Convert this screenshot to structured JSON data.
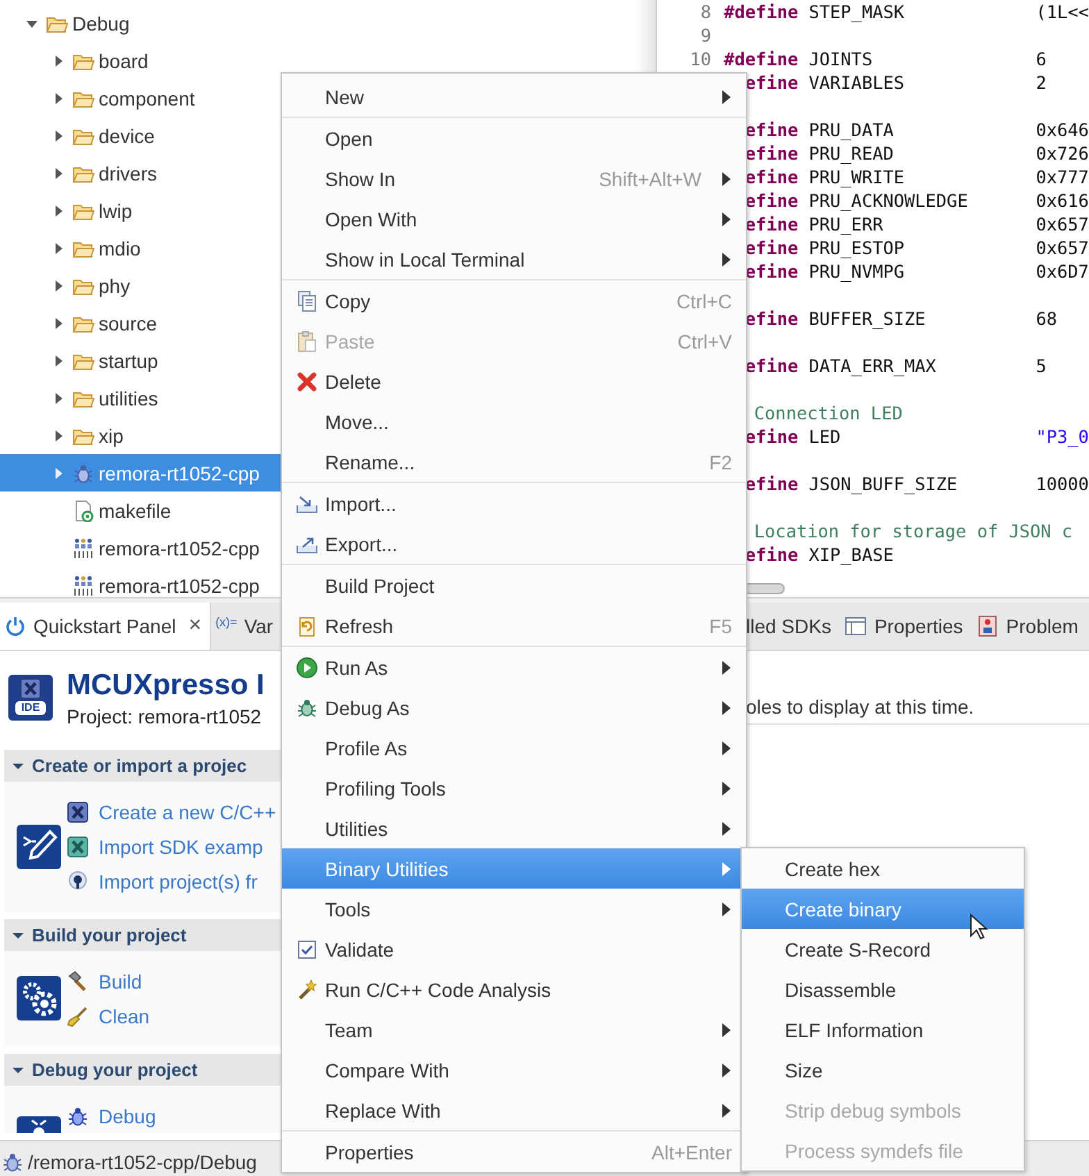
{
  "tree": {
    "items": [
      {
        "label": "Debug",
        "kind": "folder",
        "expanded": true,
        "selected": false,
        "children": [
          {
            "label": "board",
            "kind": "folder",
            "expanded": false,
            "selected": false
          },
          {
            "label": "component",
            "kind": "folder",
            "expanded": false,
            "selected": false
          },
          {
            "label": "device",
            "kind": "folder",
            "expanded": false,
            "selected": false
          },
          {
            "label": "drivers",
            "kind": "folder",
            "expanded": false,
            "selected": false
          },
          {
            "label": "lwip",
            "kind": "folder",
            "expanded": false,
            "selected": false
          },
          {
            "label": "mdio",
            "kind": "folder",
            "expanded": false,
            "selected": false
          },
          {
            "label": "phy",
            "kind": "folder",
            "expanded": false,
            "selected": false
          },
          {
            "label": "source",
            "kind": "folder",
            "expanded": false,
            "selected": false
          },
          {
            "label": "startup",
            "kind": "folder",
            "expanded": false,
            "selected": false
          },
          {
            "label": "utilities",
            "kind": "folder",
            "expanded": false,
            "selected": false
          },
          {
            "label": "xip",
            "kind": "folder",
            "expanded": false,
            "selected": false
          },
          {
            "label": "remora-rt1052-cpp",
            "kind": "executable",
            "expanded": false,
            "selected": true
          },
          {
            "label": "makefile",
            "kind": "makefile",
            "selected": false
          },
          {
            "label": "remora-rt1052-cpp",
            "kind": "binary",
            "selected": false
          },
          {
            "label": "remora-rt1052-cpp",
            "kind": "binary",
            "selected": false
          }
        ]
      }
    ]
  },
  "editor": {
    "lines": [
      {
        "number": "8",
        "kind": "define",
        "keyword": "#define",
        "name": "STEP_MASK",
        "value": "(1L<<"
      },
      {
        "number": "9",
        "kind": "blank"
      },
      {
        "number": "10",
        "kind": "define",
        "keyword": "#define",
        "name": "JOINTS",
        "value": "6"
      },
      {
        "kind": "define",
        "keyword": "efine",
        "name": "VARIABLES",
        "value": "2"
      },
      {
        "kind": "blank"
      },
      {
        "kind": "define",
        "keyword": "efine",
        "name": "PRU_DATA",
        "value": "0x646"
      },
      {
        "kind": "define",
        "keyword": "efine",
        "name": "PRU_READ",
        "value": "0x726"
      },
      {
        "kind": "define",
        "keyword": "efine",
        "name": "PRU_WRITE",
        "value": "0x777"
      },
      {
        "kind": "define",
        "keyword": "efine",
        "name": "PRU_ACKNOWLEDGE",
        "value": "0x616"
      },
      {
        "kind": "define",
        "keyword": "efine",
        "name": "PRU_ERR",
        "value": "0x657"
      },
      {
        "kind": "define",
        "keyword": "efine",
        "name": "PRU_ESTOP",
        "value": "0x657"
      },
      {
        "kind": "define",
        "keyword": "efine",
        "name": "PRU_NVMPG",
        "value": "0x6D7"
      },
      {
        "kind": "blank"
      },
      {
        "kind": "define",
        "keyword": "efine",
        "name": "BUFFER_SIZE",
        "value": "68"
      },
      {
        "kind": "blank"
      },
      {
        "kind": "define",
        "keyword": "efine",
        "name": "DATA_ERR_MAX",
        "value": "5"
      },
      {
        "kind": "blank"
      },
      {
        "kind": "comment",
        "text": "Connection LED"
      },
      {
        "kind": "string_define",
        "keyword": "efine",
        "name": "LED",
        "value": "\"P3_0"
      },
      {
        "kind": "blank"
      },
      {
        "kind": "define",
        "keyword": "efine",
        "name": "JSON_BUFF_SIZE",
        "value": "10000"
      },
      {
        "kind": "blank"
      },
      {
        "kind": "comment",
        "text": "Location for storage of JSON c"
      },
      {
        "kind": "define",
        "keyword": "efine",
        "name": "XIP_BASE"
      }
    ]
  },
  "quickstart": {
    "tabs": [
      {
        "label": "Quickstart Panel",
        "kind": "power",
        "close": "×",
        "selected": true
      },
      {
        "glyph": "(x)=",
        "label": "Var",
        "selected": false
      }
    ],
    "logo_label": "IDE",
    "title": "MCUXpresso I",
    "project": "Project: remora-rt1052",
    "sections": [
      {
        "title": "Create or import a projec",
        "expanded": true,
        "kind": "create",
        "links": [
          {
            "label": "Create a new C/C++",
            "kind": "new"
          },
          {
            "label": "Import SDK examp",
            "kind": "sdk"
          },
          {
            "label": "Import project(s) fr",
            "kind": "pin"
          }
        ]
      },
      {
        "title": "Build your project",
        "expanded": true,
        "kind": "build",
        "links": [
          {
            "label": "Build",
            "kind": "hammer"
          },
          {
            "label": "Clean",
            "kind": "broom"
          }
        ]
      },
      {
        "title": "Debug your project",
        "expanded": true,
        "kind": "debug",
        "links": [
          {
            "label": "Debug",
            "kind": "bug"
          }
        ]
      }
    ]
  },
  "side_panel": {
    "tabs": [
      {
        "label": "lled SDKs",
        "selected": false
      },
      {
        "label": "Properties",
        "kind": "table",
        "selected": false
      },
      {
        "label": "Problem",
        "kind": "problems",
        "selected": false
      }
    ],
    "message": "oles to display at this time."
  },
  "status_bar": {
    "path": "/remora-rt1052-cpp/Debug"
  },
  "context_menu": {
    "groups": [
      [
        {
          "label": "New",
          "has_submenu": true,
          "disabled": false,
          "selected": false
        }
      ],
      [
        {
          "label": "Open",
          "has_submenu": false,
          "disabled": false,
          "selected": false
        },
        {
          "label": "Show In",
          "shortcut": "Shift+Alt+W",
          "has_submenu": true,
          "disabled": false,
          "selected": false
        },
        {
          "label": "Open With",
          "has_submenu": true,
          "disabled": false,
          "selected": false
        },
        {
          "label": "Show in Local Terminal",
          "has_submenu": true,
          "disabled": false,
          "selected": false
        }
      ],
      [
        {
          "label": "Copy",
          "kind": "copy",
          "shortcut": "Ctrl+C",
          "has_submenu": false,
          "disabled": false,
          "selected": false
        },
        {
          "label": "Paste",
          "kind": "paste",
          "shortcut": "Ctrl+V",
          "has_submenu": false,
          "disabled": true,
          "selected": false
        },
        {
          "label": "Delete",
          "kind": "delete",
          "has_submenu": false,
          "disabled": false,
          "selected": false
        },
        {
          "label": "Move...",
          "has_submenu": false,
          "disabled": false,
          "selected": false
        },
        {
          "label": "Rename...",
          "shortcut": "F2",
          "has_submenu": false,
          "disabled": false,
          "selected": false
        }
      ],
      [
        {
          "label": "Import...",
          "kind": "import",
          "has_submenu": false,
          "disabled": false,
          "selected": false
        },
        {
          "label": "Export...",
          "kind": "export",
          "has_submenu": false,
          "disabled": false,
          "selected": false
        }
      ],
      [
        {
          "label": "Build Project",
          "has_submenu": false,
          "disabled": false,
          "selected": false
        },
        {
          "label": "Refresh",
          "kind": "refresh",
          "shortcut": "F5",
          "has_submenu": false,
          "disabled": false,
          "selected": false
        }
      ],
      [
        {
          "label": "Run As",
          "kind": "run",
          "has_submenu": true,
          "disabled": false,
          "selected": false
        },
        {
          "label": "Debug As",
          "kind": "debug",
          "has_submenu": true,
          "disabled": false,
          "selected": false
        },
        {
          "label": "Profile As",
          "has_submenu": true,
          "disabled": false,
          "selected": false
        },
        {
          "label": "Profiling Tools",
          "has_submenu": true,
          "disabled": false,
          "selected": false
        },
        {
          "label": "Utilities",
          "has_submenu": true,
          "disabled": false,
          "selected": false
        },
        {
          "label": "Binary Utilities",
          "has_submenu": true,
          "disabled": false,
          "selected": true
        },
        {
          "label": "Tools",
          "has_submenu": true,
          "disabled": false,
          "selected": false
        },
        {
          "label": "Validate",
          "kind": "validate",
          "has_submenu": false,
          "disabled": false,
          "selected": false
        },
        {
          "label": "Run C/C++ Code Analysis",
          "kind": "analysis",
          "has_submenu": false,
          "disabled": false,
          "selected": false
        },
        {
          "label": "Team",
          "has_submenu": true,
          "disabled": false,
          "selected": false
        },
        {
          "label": "Compare With",
          "has_submenu": true,
          "disabled": false,
          "selected": false
        },
        {
          "label": "Replace With",
          "has_submenu": true,
          "disabled": false,
          "selected": false
        }
      ],
      [
        {
          "label": "Properties",
          "shortcut": "Alt+Enter",
          "has_submenu": false,
          "disabled": false,
          "selected": false
        }
      ]
    ]
  },
  "submenu": {
    "items": [
      {
        "label": "Create hex",
        "disabled": false,
        "selected": false
      },
      {
        "label": "Create binary",
        "disabled": false,
        "selected": true
      },
      {
        "label": "Create S-Record",
        "disabled": false,
        "selected": false
      },
      {
        "label": "Disassemble",
        "disabled": false,
        "selected": false
      },
      {
        "label": "ELF Information",
        "disabled": false,
        "selected": false
      },
      {
        "label": "Size",
        "disabled": false,
        "selected": false
      },
      {
        "label": "Strip debug symbols",
        "disabled": true,
        "selected": false
      },
      {
        "label": "Process symdefs file",
        "disabled": true,
        "selected": false
      }
    ]
  }
}
